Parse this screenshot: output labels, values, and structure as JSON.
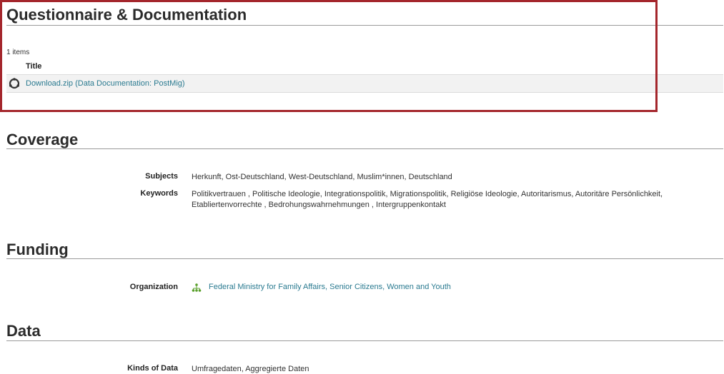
{
  "questionnaire": {
    "title": "Questionnaire & Documentation",
    "items_count": "1 items",
    "column_title": "Title",
    "file_link": "Download.zip (Data Documentation: PostMig)"
  },
  "coverage": {
    "title": "Coverage",
    "subjects_label": "Subjects",
    "subjects_value": "Herkunft, Ost-Deutschland, West-Deutschland, Muslim*innen, Deutschland",
    "keywords_label": "Keywords",
    "keywords_value": "Politikvertrauen , Politische Ideologie, Integrationspolitik, Migrationspolitik, Religiöse Ideologie, Autoritarismus, Autoritäre Persönlichkeit, Etabliertenvorrechte , Bedrohungswahrnehmungen , Intergruppenkontakt"
  },
  "funding": {
    "title": "Funding",
    "organization_label": "Organization",
    "organization_value": "Federal Ministry for Family Affairs, Senior Citizens, Women and Youth"
  },
  "data_section": {
    "title": "Data",
    "kinds_label": "Kinds of Data",
    "kinds_value": "Umfragedaten, Aggregierte Daten"
  },
  "colors": {
    "highlight_border": "#a4262c",
    "link": "#2a7a90",
    "org_icon": "#5aa02c"
  }
}
